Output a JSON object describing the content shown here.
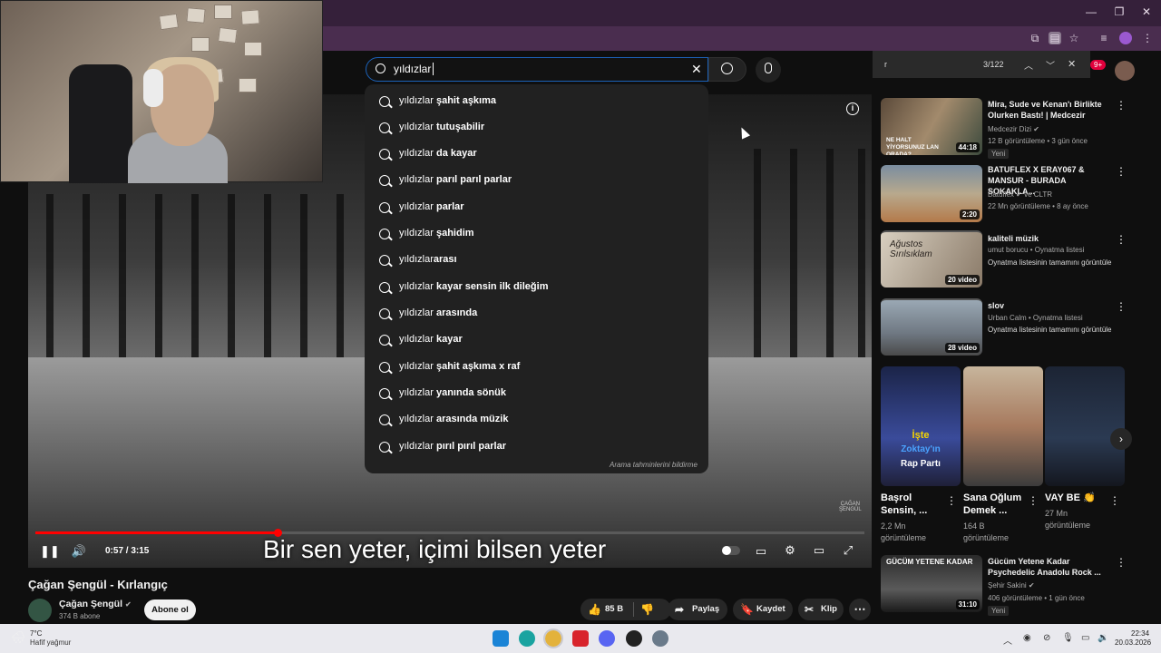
{
  "browser": {
    "find_query": "r",
    "find_count": "3/122",
    "notif_badge": "9+"
  },
  "search": {
    "query": "yıldızlar",
    "suggestions": [
      {
        "prefix": "yıldızlar ",
        "rest": "şahit aşkıma"
      },
      {
        "prefix": "yıldızlar ",
        "rest": "tutuşabilir"
      },
      {
        "prefix": "yıldızlar ",
        "rest": "da kayar"
      },
      {
        "prefix": "yıldızlar ",
        "rest": "parıl parıl parlar"
      },
      {
        "prefix": "yıldızlar ",
        "rest": "parlar"
      },
      {
        "prefix": "yıldızlar ",
        "rest": "şahidim"
      },
      {
        "prefix": "yıldızlar",
        "rest": "arası"
      },
      {
        "prefix": "yıldızlar ",
        "rest": "kayar sensin ilk dileğim"
      },
      {
        "prefix": "yıldızlar ",
        "rest": "arasında"
      },
      {
        "prefix": "yıldızlar ",
        "rest": "kayar"
      },
      {
        "prefix": "yıldızlar ",
        "rest": "şahit aşkıma x raf"
      },
      {
        "prefix": "yıldızlar ",
        "rest": "yanında sönük"
      },
      {
        "prefix": "yıldızlar ",
        "rest": "arasında müzik"
      },
      {
        "prefix": "yıldızlar ",
        "rest": "pırıl pırıl parlar"
      }
    ],
    "report_label": "Arama tahminlerini bildirme"
  },
  "player": {
    "subtitle": "Bir sen yeter, içimi bilsen yeter",
    "time": "0:57 / 3:15",
    "progress": 0.293,
    "watermark": "ÇAĞAN\nŞENGÜL"
  },
  "video": {
    "title": "Çağan Şengül - Kırlangıç",
    "channel": "Çağan Şengül",
    "subscribers": "374 B abone",
    "subscribe_label": "Abone ol",
    "likes": "85 B",
    "share_label": "Paylaş",
    "save_label": "Kaydet",
    "clip_label": "Klip"
  },
  "sidebar": {
    "videos": [
      {
        "title": "Mira, Sude ve Kenan'ı Birlikte Olurken Bastı! | Medcezir",
        "channel": "Medcezir Dizi",
        "meta": "12 B görüntüleme • 3 gün önce",
        "badge": "Yeni",
        "duration": "44:18",
        "thumb_text": "NE HALT YİYORSUNUZ LAN ORADA?"
      },
      {
        "title": "BATUFLEX X ERAY067 & MANSUR - BURADA SOKAKLA...",
        "channel": "Batuflex",
        "channel_extra": "ve CLTR",
        "meta": "22 Mn görüntüleme • 8 ay önce",
        "duration": "2:20"
      },
      {
        "title": "kaliteli müzik",
        "channel": "umut borucu • Oynatma listesi",
        "meta": "Oynatma listesinin tamamını görüntüle",
        "duration": "20 video",
        "thumb_text": "Ağustos Sırılsıklam"
      },
      {
        "title": "slov",
        "channel": "Urban Calm • Oynatma listesi",
        "meta": "Oynatma listesinin tamamını görüntüle",
        "duration": "28 video"
      },
      {
        "title": "Gücüm Yetene Kadar Psychedelic Anadolu Rock ...",
        "channel": "Şehir Sakini",
        "meta": "406 görüntüleme • 1 gün önce",
        "badge": "Yeni",
        "duration": "31:10",
        "thumb_text": "GÜCÜM YETENE KADAR"
      }
    ],
    "shorts": [
      {
        "title": "Başrol Sensin, ...",
        "views": "2,2 Mn",
        "views2": "görüntüleme",
        "overlay1": "İşte",
        "overlay2": "Zoktay'ın",
        "overlay3": "Rap Partı"
      },
      {
        "title": "Sana Oğlum Demek ...",
        "views": "164 B",
        "views2": "görüntüleme"
      },
      {
        "title": "VAY BE 👏",
        "views": "27 Mn",
        "views2": "görüntüleme"
      }
    ]
  },
  "taskbar": {
    "temp": "7°C",
    "weather": "Hafif yağmur",
    "time": "22:34",
    "date": "20.03.2026"
  },
  "colors": {
    "accent": "#ff0000",
    "search_border": "#1c62b9",
    "chrome_frame": "#35203a"
  }
}
